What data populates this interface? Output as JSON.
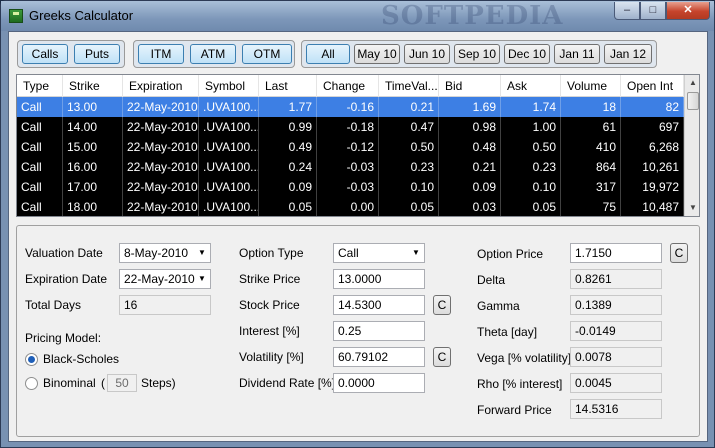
{
  "window": {
    "title": "Greeks Calculator",
    "watermark": "SOFTPEDIA",
    "min": "–",
    "max": "□",
    "close": "✕"
  },
  "filters": {
    "type": [
      "Calls",
      "Puts"
    ],
    "moneyness": [
      "ITM",
      "ATM",
      "OTM"
    ],
    "expiry": [
      "All",
      "May 10",
      "Jun 10",
      "Sep 10",
      "Dec 10",
      "Jan 11",
      "Jan 12"
    ]
  },
  "grid": {
    "columns": [
      "Type",
      "Strike",
      "Expiration",
      "Symbol",
      "Last",
      "Change",
      "TimeVal...",
      "Bid",
      "Ask",
      "Volume",
      "Open Int"
    ],
    "rows": [
      [
        "Call",
        "13.00",
        "22-May-2010",
        ".UVA100...",
        "1.77",
        "-0.16",
        "0.21",
        "1.69",
        "1.74",
        "18",
        "82"
      ],
      [
        "Call",
        "14.00",
        "22-May-2010",
        ".UVA100...",
        "0.99",
        "-0.18",
        "0.47",
        "0.98",
        "1.00",
        "61",
        "697"
      ],
      [
        "Call",
        "15.00",
        "22-May-2010",
        ".UVA100...",
        "0.49",
        "-0.12",
        "0.50",
        "0.48",
        "0.50",
        "410",
        "6,268"
      ],
      [
        "Call",
        "16.00",
        "22-May-2010",
        ".UVA100...",
        "0.24",
        "-0.03",
        "0.23",
        "0.21",
        "0.23",
        "864",
        "10,261"
      ],
      [
        "Call",
        "17.00",
        "22-May-2010",
        ".UVA100...",
        "0.09",
        "-0.03",
        "0.10",
        "0.09",
        "0.10",
        "317",
        "19,972"
      ],
      [
        "Call",
        "18.00",
        "22-May-2010",
        ".UVA100...",
        "0.05",
        "0.00",
        "0.05",
        "0.03",
        "0.05",
        "75",
        "10,487"
      ]
    ],
    "selected_row": 0
  },
  "left": {
    "valuation_label": "Valuation Date",
    "valuation_value": "8-May-2010",
    "expiration_label": "Expiration Date",
    "expiration_value": "22-May-2010",
    "total_days_label": "Total Days",
    "total_days_value": "16",
    "pricing_label": "Pricing Model:",
    "bs_label": "Black-Scholes",
    "binomial_label": "Binominal",
    "steps_open": "(",
    "steps_value": "50",
    "steps_label": "Steps)"
  },
  "middle": {
    "option_type_label": "Option Type",
    "option_type_value": "Call",
    "strike_label": "Strike Price",
    "strike_value": "13.0000",
    "stock_label": "Stock Price",
    "stock_value": "14.5300",
    "interest_label": "Interest [%]",
    "interest_value": "0.25",
    "volatility_label": "Volatility [%]",
    "volatility_value": "60.79102",
    "dividend_label": "Dividend Rate [%]",
    "dividend_value": "0.0000",
    "c_label": "C"
  },
  "right": {
    "option_price_label": "Option Price",
    "option_price_value": "1.7150",
    "delta_label": "Delta",
    "delta_value": "0.8261",
    "gamma_label": "Gamma",
    "gamma_value": "0.1389",
    "theta_label": "Theta [day]",
    "theta_value": "-0.0149",
    "vega_label": "Vega [% volatility]",
    "vega_value": "0.0078",
    "rho_label": "Rho [% interest]",
    "rho_value": "0.0045",
    "forward_label": "Forward Price",
    "forward_value": "14.5316"
  },
  "colors": {
    "selected_row": "#3d7fe4",
    "grid_rows": "#000000",
    "grid_text": "#ffffff"
  }
}
